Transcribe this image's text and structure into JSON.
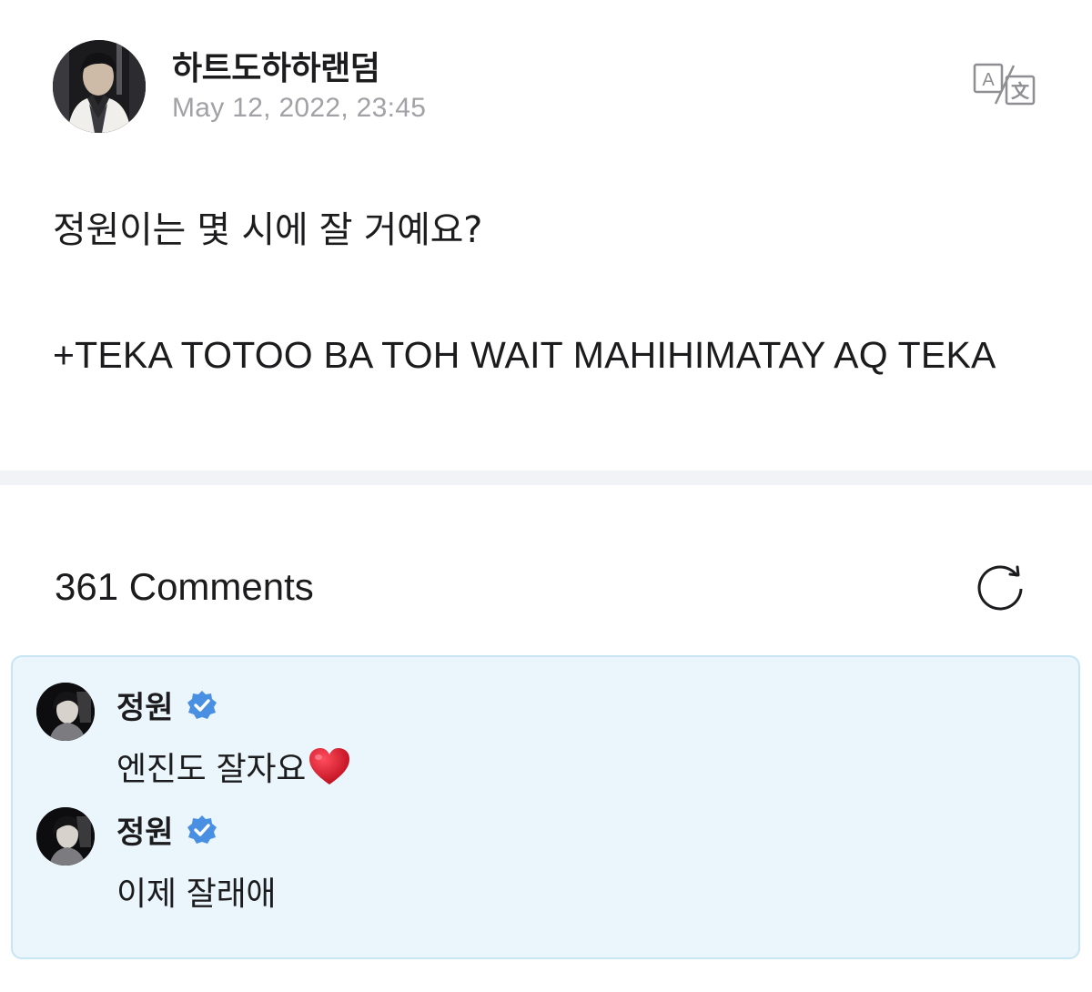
{
  "post": {
    "author": "하트도하하랜덤",
    "date": "May 12, 2022, 23:45",
    "text_line1": "정원이는 몇 시에 잘 거예요?",
    "text_line2": "+TEKA TOTOO BA TOH WAIT MAHIHIMATAY AQ TEKA",
    "translate_icon": "translate-icon",
    "avatar_icon": "user-avatar"
  },
  "comments": {
    "count_label": "361 Comments",
    "refresh_icon": "refresh-icon",
    "items": [
      {
        "author": "정원",
        "verified": true,
        "text": "엔진도 잘자요",
        "emoji": "heart-emoji"
      },
      {
        "author": "정원",
        "verified": true,
        "text": "이제 잘래애"
      }
    ]
  },
  "colors": {
    "verified_badge": "#4a90e2",
    "comment_bg": "#ebf6fc",
    "comment_border": "#c7e5f3",
    "date_text": "#a1a1a6",
    "divider": "#f2f3f6",
    "heart": "#d42032"
  }
}
